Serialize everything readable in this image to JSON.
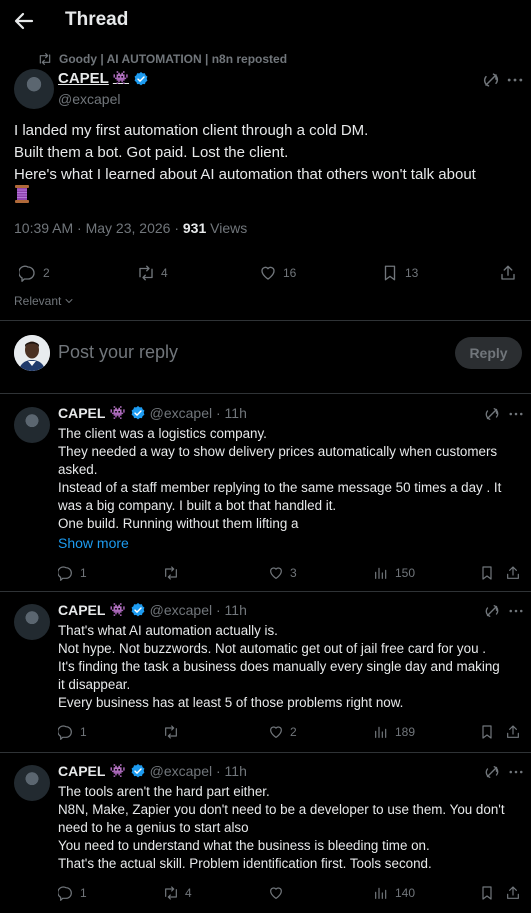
{
  "header": {
    "title": "Thread",
    "back_icon": "arrow-left-icon"
  },
  "repost": {
    "text": "Goody | AI AUTOMATION | n8n reposted"
  },
  "main_post": {
    "name": "CAPEL",
    "badge": "👾",
    "handle": "@excapel",
    "lines": [
      "I landed my first automation client through a cold DM.",
      "Built them a bot. Got paid. Lost the client.",
      "Here's what I learned about AI automation that others won't talk about"
    ],
    "time": "10:39 AM · May 23, 2026",
    "sep": " · ",
    "views": "931",
    "views_label": " Views",
    "stats": {
      "replies": "2",
      "reposts": "4",
      "likes": "16",
      "bookmarks": "13"
    }
  },
  "filter": {
    "label": "Relevant"
  },
  "reply_box": {
    "placeholder": "Post your reply",
    "button": "Reply"
  },
  "replies": [
    {
      "name": "CAPEL",
      "badge": "👾",
      "handle": "@excapel · 11h",
      "lines": [
        "The client was a logistics company.",
        "They needed a way to show delivery prices automatically when customers",
        "asked.",
        "Instead of a staff member replying to the same message 50 times a day . It",
        "was a big company. I built a bot that handled it.",
        "One build. Running without them lifting a"
      ],
      "show_more": "Show more",
      "stats": {
        "replies": "1",
        "reposts": "",
        "likes": "3",
        "views": "150"
      }
    },
    {
      "name": "CAPEL",
      "badge": "👾",
      "handle": "@excapel · 11h",
      "lines": [
        "That's what AI automation actually is.",
        "Not hype. Not buzzwords. Not automatic get out of jail free card for you .",
        "It's finding the task a business does manually every single day and making",
        "it disappear.",
        "Every business has at least 5 of those problems right now."
      ],
      "show_more": "",
      "stats": {
        "replies": "1",
        "reposts": "",
        "likes": "2",
        "views": "189"
      }
    },
    {
      "name": "CAPEL",
      "badge": "👾",
      "handle": "@excapel · 11h",
      "lines": [
        "The tools aren't the hard part either.",
        "N8N, Make, Zapier  you don't need to be a developer to use them. You don't",
        "need to he a genius to start also",
        "You need to understand what the business is bleeding time on.",
        "That's the actual skill. Problem identification first. Tools second."
      ],
      "show_more": "",
      "stats": {
        "replies": "1",
        "reposts": "4",
        "likes": "",
        "views": "140"
      }
    }
  ],
  "colors": {
    "accent": "#1d9bf0",
    "verified": "#1d9bf0",
    "text": "#e7e9ea",
    "muted": "#71767b",
    "border": "#2f3336"
  }
}
